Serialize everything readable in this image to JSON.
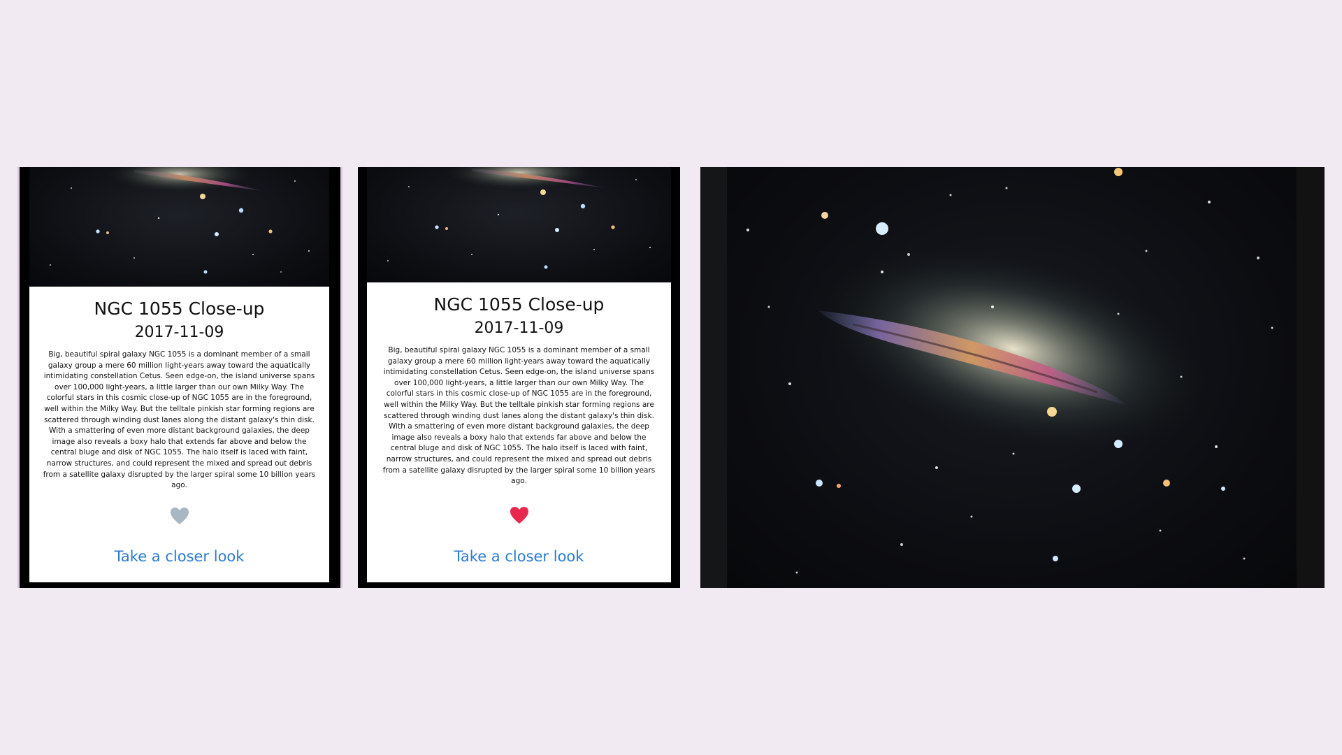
{
  "screens": [
    {
      "title": "NGC 1055 Close-up",
      "date": "2017-11-09",
      "description": "Big, beautiful spiral galaxy NGC 1055 is a dominant member of a small galaxy group a mere 60 million light-years away toward the aquatically intimidating constellation Cetus. Seen edge-on, the island universe spans over 100,000 light-years, a little larger than our own Milky Way. The colorful stars in this cosmic close-up of NGC 1055 are in the foreground, well within the Milky Way. But the telltale pinkish star forming regions are scattered through winding dust lanes along the distant galaxy's thin disk. With a smattering of even more distant background galaxies, the deep image also reveals a boxy halo that extends far above and below the central bluge and disk of NGC 1055. The halo itself is laced with faint, narrow structures, and could represent the mixed and spread out debris from a satellite galaxy disrupted by the larger spiral some 10 billion years ago.",
      "favorite": false,
      "heart_color": "#a9b6c3",
      "link_label": "Take a closer look"
    },
    {
      "title": "NGC 1055 Close-up",
      "date": "2017-11-09",
      "description": "Big, beautiful spiral galaxy NGC 1055 is a dominant member of a small galaxy group a mere 60 million light-years away toward the aquatically intimidating constellation Cetus. Seen edge-on, the island universe spans over 100,000 light-years, a little larger than our own Milky Way. The colorful stars in this cosmic close-up of NGC 1055 are in the foreground, well within the Milky Way. But the telltale pinkish star forming regions are scattered through winding dust lanes along the distant galaxy's thin disk. With a smattering of even more distant background galaxies, the deep image also reveals a boxy halo that extends far above and below the central bluge and disk of NGC 1055. The halo itself is laced with faint, narrow structures, and could represent the mixed and spread out debris from a satellite galaxy disrupted by the larger spiral some 10 billion years ago.",
      "favorite": true,
      "heart_color": "#e8284f",
      "link_label": "Take a closer look"
    }
  ],
  "colors": {
    "page_background": "#f1eaf3",
    "link": "#2a7bd1"
  },
  "icons": {
    "favorite": "heart-icon"
  }
}
